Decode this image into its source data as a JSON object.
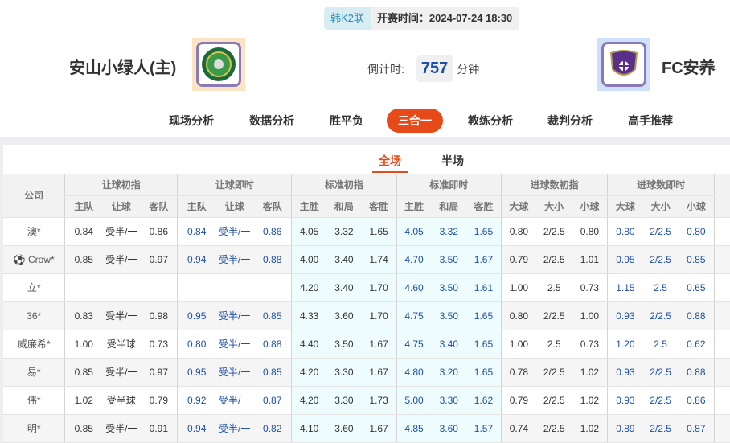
{
  "match": {
    "league": "韩K2联",
    "start_label": "开赛时间：",
    "start_time": "2024-07-24 18:30",
    "home": "安山小绿人(主)",
    "away": "FC安养",
    "countdown_label": "倒计时:",
    "countdown": "757",
    "countdown_unit": "分钟"
  },
  "nav": [
    "现场分析",
    "数据分析",
    "胜平负",
    "三合一",
    "教练分析",
    "裁判分析",
    "高手推荐"
  ],
  "nav_active": "三合一",
  "subtabs": [
    "全场",
    "半场"
  ],
  "table": {
    "company_header": "公司",
    "groups": [
      "让球初指",
      "让球即时",
      "标准初指",
      "标准即时",
      "进球数初指",
      "进球数即时"
    ],
    "subheaders": [
      "主队",
      "让球",
      "客队",
      "主队",
      "让球",
      "客队",
      "主胜",
      "和局",
      "客胜",
      "主胜",
      "和局",
      "客胜",
      "大球",
      "大小",
      "小球",
      "大球",
      "大小",
      "小球"
    ],
    "rows": [
      {
        "company": "澳*",
        "icon": false,
        "v": [
          "0.84",
          "受半/一",
          "0.86",
          "0.84",
          "受半/一",
          "0.86",
          "4.05",
          "3.32",
          "1.65",
          "4.05",
          "3.32",
          "1.65",
          "0.80",
          "2/2.5",
          "0.80",
          "0.80",
          "2/2.5",
          "0.80"
        ]
      },
      {
        "company": "Crow*",
        "icon": true,
        "v": [
          "0.85",
          "受半/一",
          "0.97",
          "0.94",
          "受半/一",
          "0.88",
          "4.00",
          "3.40",
          "1.74",
          "4.70",
          "3.50",
          "1.67",
          "0.79",
          "2/2.5",
          "1.01",
          "0.95",
          "2/2.5",
          "0.85"
        ]
      },
      {
        "company": "立*",
        "icon": false,
        "v": [
          "",
          "",
          "",
          "",
          "",
          "",
          "4.20",
          "3.40",
          "1.70",
          "4.60",
          "3.50",
          "1.61",
          "1.00",
          "2.5",
          "0.73",
          "1.15",
          "2.5",
          "0.65"
        ]
      },
      {
        "company": "36*",
        "icon": false,
        "v": [
          "0.83",
          "受半/一",
          "0.98",
          "0.95",
          "受半/一",
          "0.85",
          "4.33",
          "3.60",
          "1.70",
          "4.75",
          "3.50",
          "1.65",
          "0.80",
          "2/2.5",
          "1.00",
          "0.93",
          "2/2.5",
          "0.88"
        ]
      },
      {
        "company": "威廉希*",
        "icon": false,
        "v": [
          "1.00",
          "受半球",
          "0.73",
          "0.80",
          "受半/一",
          "0.88",
          "4.40",
          "3.50",
          "1.67",
          "4.75",
          "3.40",
          "1.65",
          "1.00",
          "2.5",
          "0.73",
          "1.20",
          "2.5",
          "0.62"
        ]
      },
      {
        "company": "易*",
        "icon": false,
        "v": [
          "0.85",
          "受半/一",
          "0.97",
          "0.95",
          "受半/一",
          "0.85",
          "4.20",
          "3.30",
          "1.67",
          "4.80",
          "3.20",
          "1.65",
          "0.78",
          "2/2.5",
          "1.02",
          "0.93",
          "2/2.5",
          "0.88"
        ]
      },
      {
        "company": "伟*",
        "icon": false,
        "v": [
          "1.02",
          "受半球",
          "0.79",
          "0.92",
          "受半/一",
          "0.87",
          "4.20",
          "3.30",
          "1.73",
          "5.00",
          "3.30",
          "1.62",
          "0.79",
          "2/2.5",
          "1.02",
          "0.93",
          "2/2.5",
          "0.86"
        ]
      },
      {
        "company": "明*",
        "icon": false,
        "v": [
          "0.85",
          "受半/一",
          "0.91",
          "0.94",
          "受半/一",
          "0.82",
          "4.10",
          "3.60",
          "1.67",
          "4.85",
          "3.60",
          "1.57",
          "0.74",
          "2/2.5",
          "1.02",
          "0.89",
          "2/2.5",
          "0.87"
        ]
      }
    ]
  },
  "colors": {
    "accent": "#e64a19",
    "live": "#1d4fa8",
    "standard_bg": "#effcfd"
  }
}
